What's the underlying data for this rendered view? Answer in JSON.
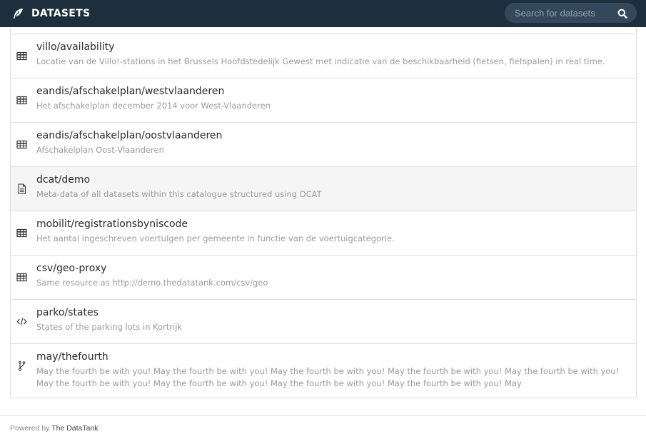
{
  "header": {
    "title": "DATASETS",
    "logo_icon": "feather-icon",
    "search": {
      "placeholder": "Search for datasets",
      "value": ""
    }
  },
  "colors": {
    "topbar": "#1d2f3d",
    "search_bg": "#33495b",
    "highlight_row": "#f5f5f5",
    "desc_text": "#9a9a9a"
  },
  "datasets": [
    {
      "icon": "table-icon",
      "title": "villo/availability",
      "description": "Locatie van de Villo!-stations in het Brussels Hoofdstedelijk Gewest met indicatie van de beschikbaarheid (fietsen, fietspalen) in real time."
    },
    {
      "icon": "table-icon",
      "title": "eandis/afschakelplan/westvlaanderen",
      "description": "Het afschakelplan december 2014 voor West-Vlaanderen"
    },
    {
      "icon": "table-icon",
      "title": "eandis/afschakelplan/oostvlaanderen",
      "description": "Afschakelplan Oost-Vlaanderen"
    },
    {
      "icon": "document-icon",
      "title": "dcat/demo",
      "description": "Meta-data of all datasets within this catalogue structured using DCAT"
    },
    {
      "icon": "table-icon",
      "title": "mobilit/registrationsbyniscode",
      "description": "Het aantal ingeschreven voertuigen per gemeente in functie van de voertuigcategorie."
    },
    {
      "icon": "table-icon",
      "title": "csv/geo-proxy",
      "description": "Same resource as http://demo.thedatatank.com/csv/geo"
    },
    {
      "icon": "code-icon",
      "title": "parko/states",
      "description": "States of the parking lots in Kortrijk"
    },
    {
      "icon": "branch-icon",
      "title": "may/thefourth",
      "description": "May the fourth be with you! May the fourth be with you! May the fourth be with you! May the fourth be with you! May the fourth be with you! May the fourth be with you! May the fourth be with you! May the fourth be with you! May the fourth be with you! May"
    }
  ],
  "footer": {
    "prefix": "Powered by",
    "link": "The DataTank"
  }
}
